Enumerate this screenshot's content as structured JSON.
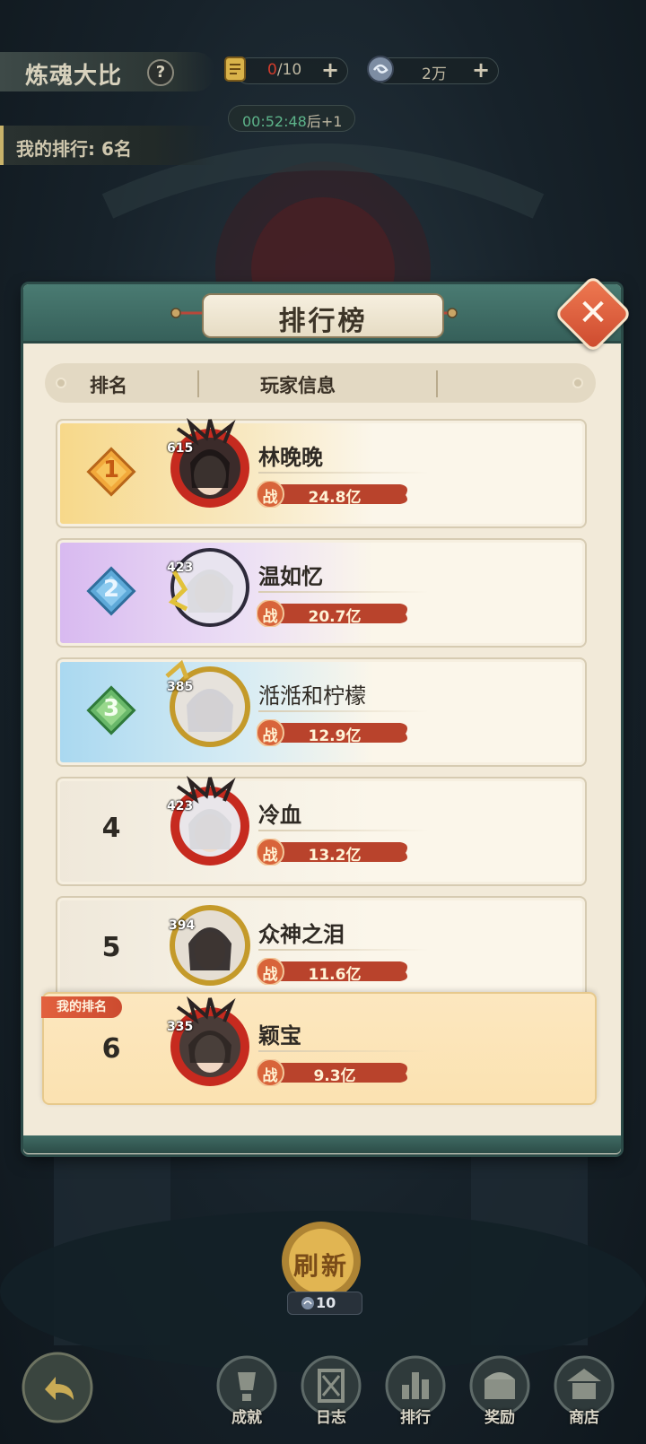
{
  "header": {
    "title": "炼魂大比",
    "help_symbol": "?",
    "res1_current": "0",
    "res1_total": "/10",
    "res2_value": "2万",
    "plus_symbol": "+",
    "timer_time": "00:52:48",
    "timer_suffix": "后+1",
    "my_rank_text": "我的排行: 6名"
  },
  "panel": {
    "title": "排行榜",
    "close_symbol": "✕",
    "col_rank": "排名",
    "col_player": "玩家信息"
  },
  "rows": [
    {
      "rank": "1",
      "level": "615",
      "name": "林晚晚",
      "power_label": "战",
      "power": "24.8亿"
    },
    {
      "rank": "2",
      "level": "423",
      "name": "温如忆",
      "power_label": "战",
      "power": "20.7亿"
    },
    {
      "rank": "3",
      "level": "385",
      "name": "湉湉和柠檬",
      "power_label": "战",
      "power": "12.9亿"
    },
    {
      "rank": "4",
      "level": "423",
      "name": "冷血",
      "power_label": "战",
      "power": "13.2亿"
    },
    {
      "rank": "5",
      "level": "394",
      "name": "众神之泪",
      "power_label": "战",
      "power": "11.6亿"
    }
  ],
  "my_row": {
    "tag": "我的排名",
    "rank": "6",
    "level": "335",
    "name": "颖宝",
    "power_label": "战",
    "power": "9.3亿"
  },
  "bottom": {
    "refresh_label": "刷新",
    "refresh_cost": "10",
    "nav": [
      {
        "label": "成就",
        "icon": "achievement-icon"
      },
      {
        "label": "日志",
        "icon": "log-icon"
      },
      {
        "label": "排行",
        "icon": "ranking-icon"
      },
      {
        "label": "奖励",
        "icon": "reward-chest-icon"
      },
      {
        "label": "商店",
        "icon": "shop-icon"
      }
    ]
  },
  "colors": {
    "accent_teal": "#36605a",
    "close_red": "#cd4a2e",
    "gold_row": "#f7d889",
    "purple_row": "#d8b9f0",
    "blue_row": "#a9d8f0",
    "my_row": "#fce7bf",
    "power_bar": "#b9432c",
    "timer_green": "#5db48a"
  }
}
